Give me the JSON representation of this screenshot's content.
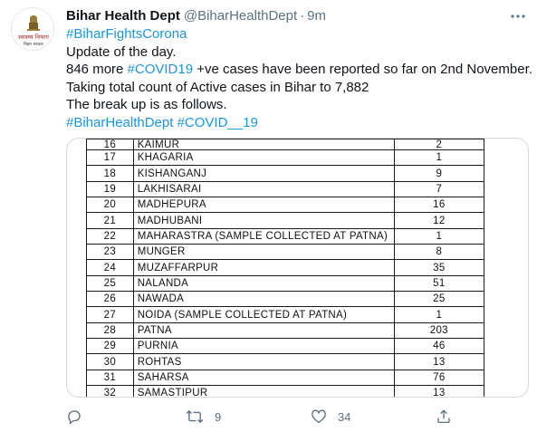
{
  "tweet": {
    "display_name": "Bihar Health Dept",
    "handle": "@BiharHealthDept",
    "separator": "·",
    "time": "9m",
    "avatar_text": "स्वास्थ्य विभाग",
    "avatar_subtext": "बिहार सरकार",
    "lines": [
      {
        "type": "hashtag",
        "text": "#BiharFightsCorona"
      },
      {
        "type": "text",
        "text": "Update of the day."
      }
    ],
    "line3": {
      "pre": "846 more ",
      "tag": "#COVID19",
      "post": " +ve cases have been reported so far on 2nd November."
    },
    "line4": "Taking total count of Active cases in Bihar to 7,882",
    "line5": "The break up is as follows.",
    "line6": {
      "tag1": "#BiharHealthDept",
      "space": " ",
      "tag2": "#COVID__19"
    }
  },
  "media": {
    "rows": [
      {
        "sn": "16",
        "district": "KAIMUR",
        "value": "2"
      },
      {
        "sn": "17",
        "district": "KHAGARIA",
        "value": "1"
      },
      {
        "sn": "18",
        "district": "KISHANGANJ",
        "value": "9"
      },
      {
        "sn": "19",
        "district": "LAKHISARAI",
        "value": "7"
      },
      {
        "sn": "20",
        "district": "MADHEPURA",
        "value": "16"
      },
      {
        "sn": "21",
        "district": "MADHUBANI",
        "value": "12"
      },
      {
        "sn": "22",
        "district": "MAHARASTRA (SAMPLE COLLECTED AT PATNA)",
        "value": "1"
      },
      {
        "sn": "23",
        "district": "MUNGER",
        "value": "8"
      },
      {
        "sn": "24",
        "district": "MUZAFFARPUR",
        "value": "35"
      },
      {
        "sn": "25",
        "district": "NALANDA",
        "value": "51"
      },
      {
        "sn": "26",
        "district": "NAWADA",
        "value": "25"
      },
      {
        "sn": "27",
        "district": "NOIDA (SAMPLE COLLECTED AT PATNA)",
        "value": "1"
      },
      {
        "sn": "28",
        "district": "PATNA",
        "value": "203"
      },
      {
        "sn": "29",
        "district": "PURNIA",
        "value": "46"
      },
      {
        "sn": "30",
        "district": "ROHTAS",
        "value": "13"
      },
      {
        "sn": "31",
        "district": "SAHARSA",
        "value": "76"
      },
      {
        "sn": "32",
        "district": "SAMASTIPUR",
        "value": "13"
      }
    ]
  },
  "actions": {
    "reply_icon": "reply-icon",
    "retweet_icon": "retweet-icon",
    "like_icon": "like-icon",
    "share_icon": "share-icon",
    "retweet_count": "9",
    "like_count": "34"
  },
  "colors": {
    "link": "#1b95e0",
    "secondary_text": "#5b7083",
    "primary_text": "#0f1419"
  }
}
